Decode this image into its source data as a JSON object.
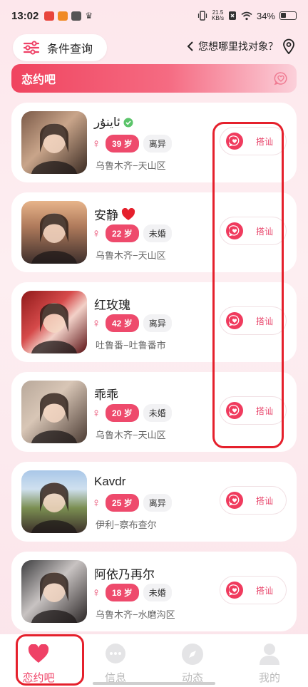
{
  "status_bar": {
    "time": "13:02",
    "speed_top": "21.5",
    "speed_bottom": "KB/s",
    "battery": "34%"
  },
  "top": {
    "filter_label": "条件查询",
    "where_label": "您想哪里找对象？"
  },
  "banner": {
    "title": "恋约吧"
  },
  "users": [
    {
      "name": "ئاينۇر",
      "verified": true,
      "heart": false,
      "age": "39 岁",
      "status": "离异",
      "location": "乌鲁木齐−天山区",
      "greet": "搭讪"
    },
    {
      "name": "安静",
      "verified": false,
      "heart": true,
      "age": "22 岁",
      "status": "未婚",
      "location": "乌鲁木齐−天山区",
      "greet": "搭讪"
    },
    {
      "name": "红玫瑰",
      "verified": false,
      "heart": false,
      "age": "42 岁",
      "status": "离异",
      "location": "吐鲁番−吐鲁番市",
      "greet": "搭讪"
    },
    {
      "name": "乖乖",
      "verified": false,
      "heart": false,
      "age": "20 岁",
      "status": "未婚",
      "location": "乌鲁木齐−天山区",
      "greet": "搭讪"
    },
    {
      "name": "Kavdr",
      "verified": false,
      "heart": false,
      "age": "25 岁",
      "status": "离异",
      "location": "伊利−察布查尔",
      "greet": "搭讪"
    },
    {
      "name": "阿依乃再尔",
      "verified": false,
      "heart": false,
      "age": "18 岁",
      "status": "未婚",
      "location": "乌鲁木齐−水磨沟区",
      "greet": "搭讪"
    }
  ],
  "nav": [
    {
      "label": "恋约吧",
      "icon": "heart-icon",
      "active": true
    },
    {
      "label": "信息",
      "icon": "chat-icon",
      "active": false
    },
    {
      "label": "动态",
      "icon": "compass-icon",
      "active": false
    },
    {
      "label": "我的",
      "icon": "user-icon",
      "active": false
    }
  ],
  "colors": {
    "accent": "#ef4166",
    "highlight": "#e5202c"
  }
}
